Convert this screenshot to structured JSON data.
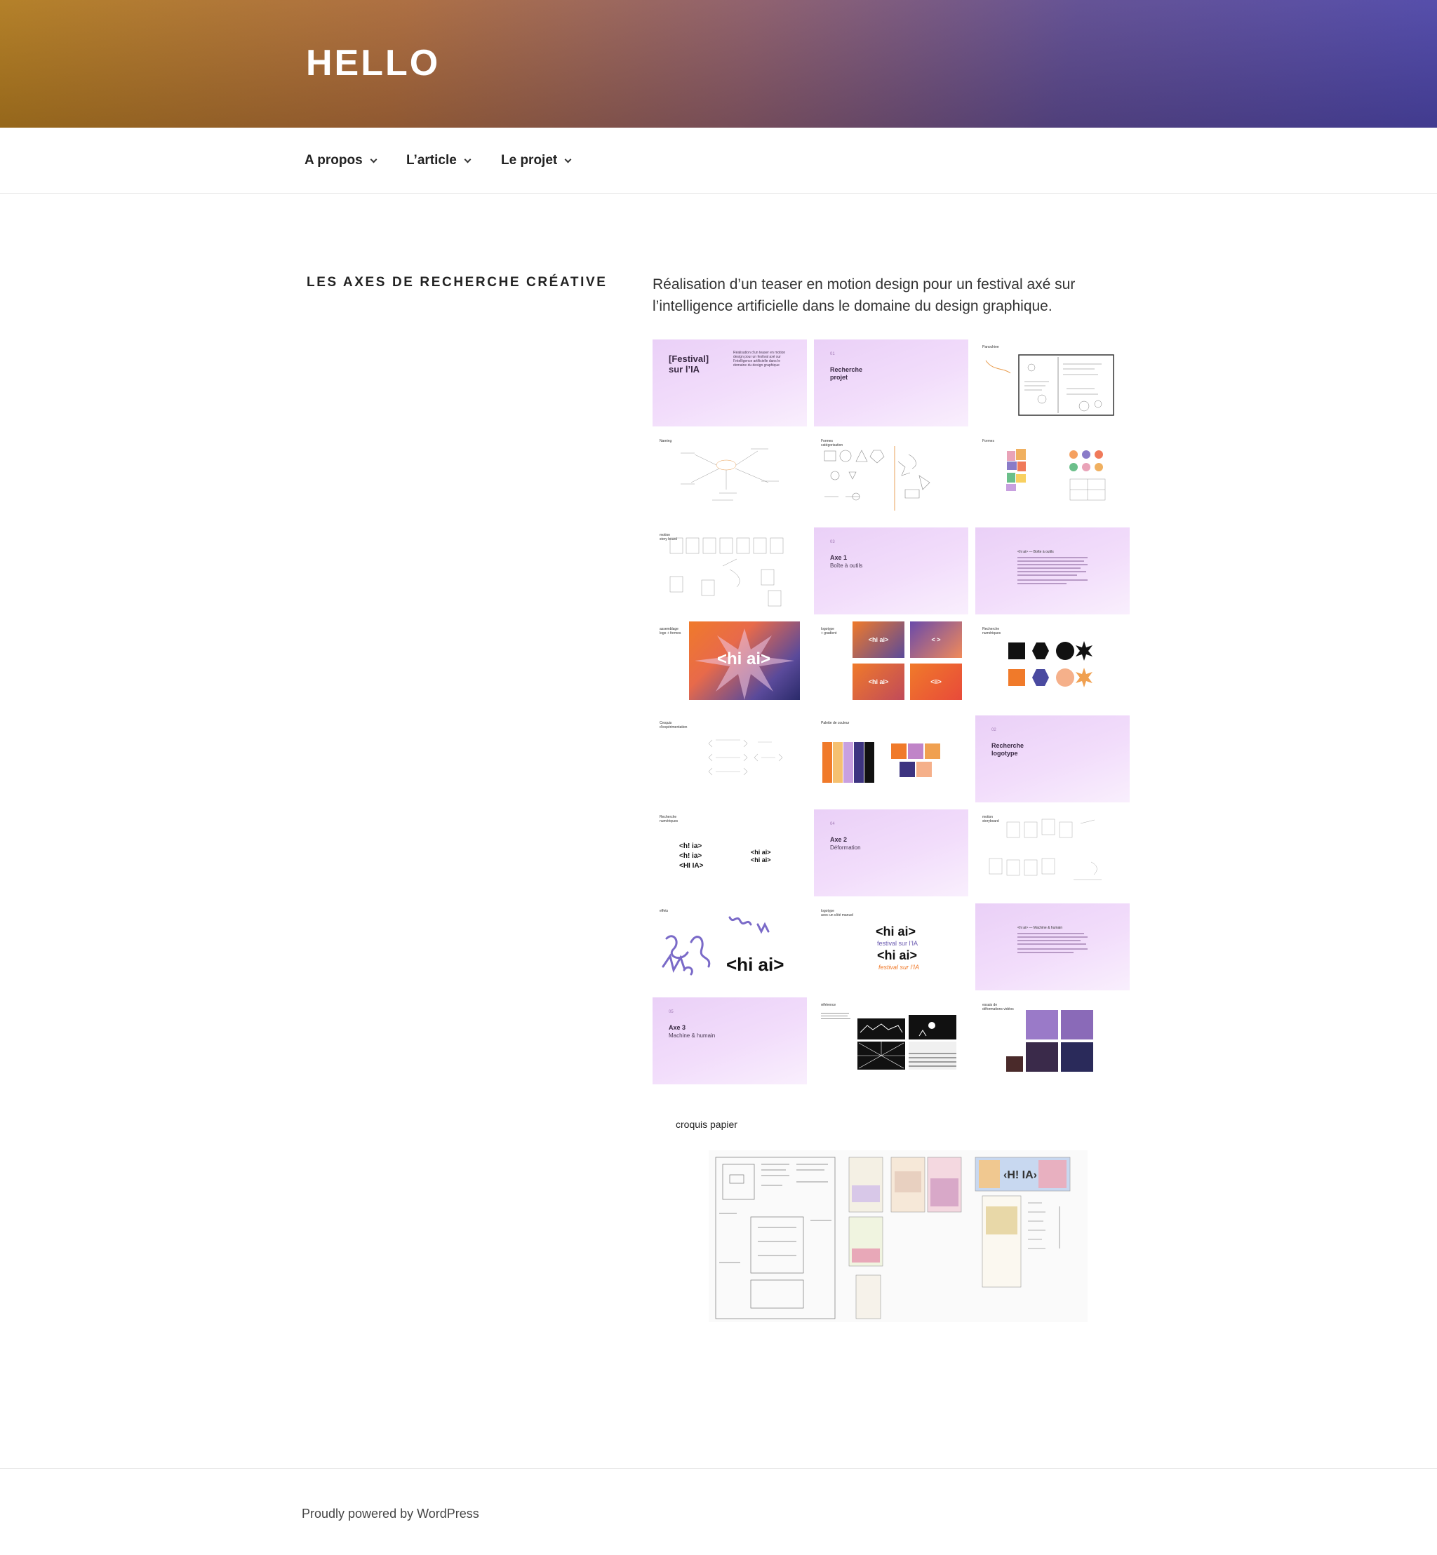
{
  "site": {
    "title": "HELLO"
  },
  "nav": {
    "items": [
      {
        "label": "A propos"
      },
      {
        "label": "L’article"
      },
      {
        "label": "Le projet"
      }
    ]
  },
  "page": {
    "title": "LES AXES DE RECHERCHE CRÉATIVE",
    "intro": "Réalisation d’un teaser en motion design pour un festival axé sur l’intelligence artificielle dans le domaine du design graphique."
  },
  "slides": {
    "s1": {
      "title": "[Festival]\nsur l’IA",
      "desc": "Réalisation d’un teaser en motion design pour un festival axé sur l’intelligence artificielle dans le domaine du design graphique"
    },
    "s2": {
      "num": "01",
      "title": "Recherche\nprojet"
    },
    "s3": {
      "label": "Panochiee"
    },
    "s4": {
      "label": "Naming"
    },
    "s5": {
      "label": "Formes\ncatégorisation"
    },
    "s6": {
      "label": "Formes"
    },
    "s7": {
      "label": "motion\nstory board"
    },
    "s8": {
      "num": "03",
      "title": "Axe 1",
      "sub": "Boîte à outils"
    },
    "s9": {
      "label": "<hi ai> — Boîte à outils"
    },
    "s10": {
      "label": "assemblage\nlogo + formes",
      "logo": "<hi ai>"
    },
    "s11": {
      "label": "logotype\n+ gradient",
      "a": "<hi ai>",
      "b": "< >",
      "c": "<hi ai>",
      "d": "<ii>"
    },
    "s12": {
      "label": "Recherche\nnumériques"
    },
    "s13": {
      "label": "Croquis\nd’expérimentation"
    },
    "s14": {
      "label": "Palette de couleur"
    },
    "s15": {
      "num": "02",
      "title": "Recherche\nlogotype"
    },
    "s16": {
      "label": "Recherche\nnumériques",
      "l1": "<h! ia>",
      "l2": "<h! ia>",
      "l3": "<HI IA>",
      "r1": "<hi ai>",
      "r2": "<hi ai>"
    },
    "s17": {
      "num": "04",
      "title": "Axe 2",
      "sub": "Déformation"
    },
    "s18": {
      "label": "motion\nstoryboard"
    },
    "s19": {
      "label": "effets",
      "logo": "<hi ai>"
    },
    "s20": {
      "label": "logotype\navec un côté manuel",
      "a": "<hi ai>",
      "b": "festival sur l’IA",
      "c": "<hi ai>",
      "d": "festival sur l’IA"
    },
    "s21": {
      "label": "<hi ai> — Machine & humain"
    },
    "s22": {
      "num": "05",
      "title": "Axe 3",
      "sub": "Machine & humain"
    },
    "s23": {
      "label": "référence"
    },
    "s24": {
      "label": "essais de\ndéformations vidéos"
    }
  },
  "croquis": {
    "label": "croquis papier"
  },
  "footer": {
    "text": "Proudly powered by WordPress"
  },
  "colors": {
    "header_start": "#b07a1e",
    "header_end": "#4c45a8",
    "slide_pink": "#ecd3f8",
    "accent_orange": "#f07a2a",
    "accent_purple": "#3d3480"
  }
}
